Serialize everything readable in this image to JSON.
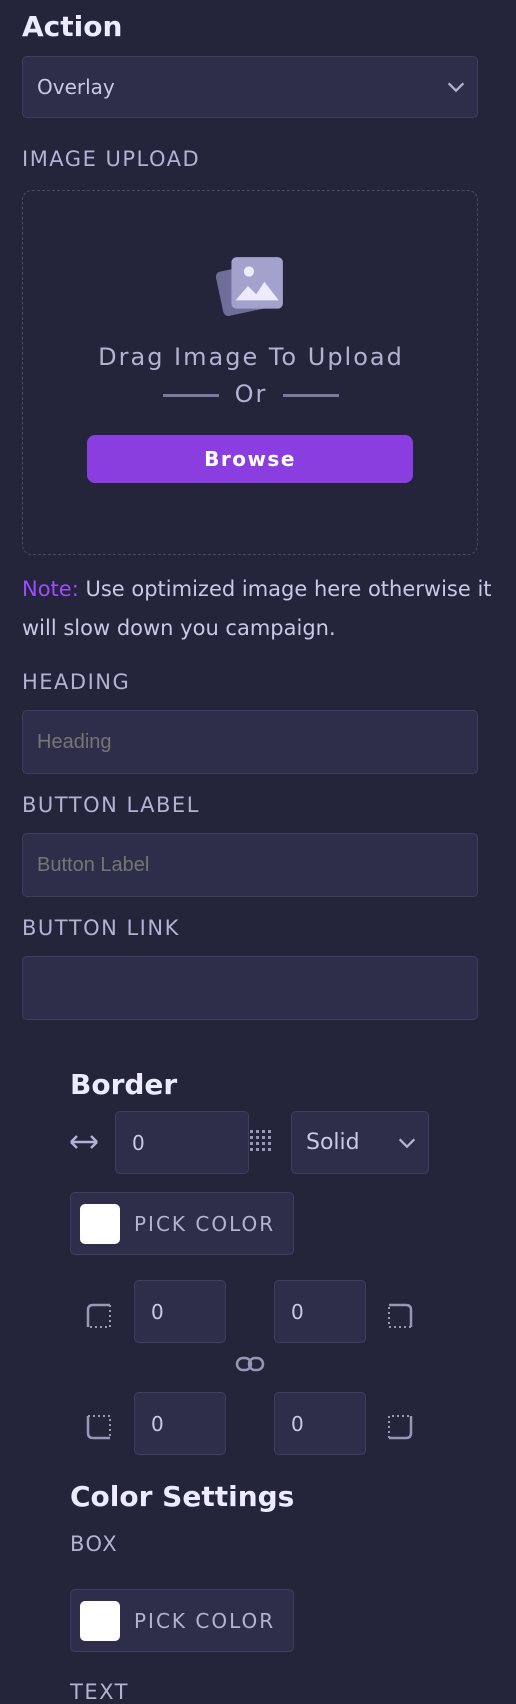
{
  "action": {
    "heading": "Action",
    "select_value": "Overlay"
  },
  "image_upload": {
    "label": "IMAGE UPLOAD",
    "drag_text": "Drag Image To Upload",
    "or_text": "Or",
    "browse_label": "Browse"
  },
  "note": {
    "prefix": "Note:",
    "text": " Use optimized image here otherwise it will slow down you campaign."
  },
  "heading_field": {
    "label": "HEADING",
    "placeholder": "Heading"
  },
  "button_label_field": {
    "label": "BUTTON LABEL",
    "placeholder": "Button Label"
  },
  "button_link_field": {
    "label": "BUTTON LINK",
    "value": ""
  },
  "border": {
    "title": "Border",
    "width_value": "0",
    "style_value": "Solid",
    "pick_color_label": "PICK COLOR",
    "radius_top_left": "0",
    "radius_top_right": "0",
    "radius_bottom_left": "0",
    "radius_bottom_right": "0"
  },
  "color_settings": {
    "title": "Color Settings",
    "box_label": "BOX",
    "box_pick_label": "PICK COLOR",
    "text_label": "TEXT"
  },
  "colors": {
    "background": "#24243a",
    "field_bg": "#2f2e4a",
    "accent": "#8b3ee0",
    "note_accent": "#9b4dff",
    "swatch": "#ffffff"
  },
  "icons": [
    "chevron-down-icon",
    "image-icon",
    "horizontal-arrows-icon",
    "dotted-grid-icon",
    "corner-top-left-icon",
    "corner-top-right-icon",
    "corner-bottom-left-icon",
    "corner-bottom-right-icon",
    "link-icon"
  ]
}
